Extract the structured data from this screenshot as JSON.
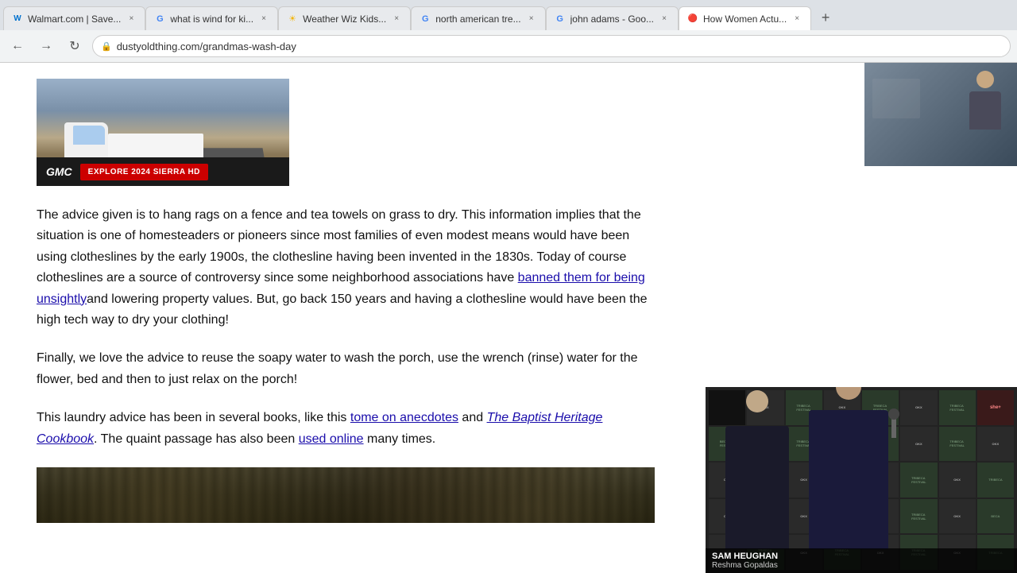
{
  "browser": {
    "tabs": [
      {
        "id": "tab1",
        "favicon": "W",
        "favicon_color": "#0071ce",
        "label": "Walmart.com | Save...",
        "active": false
      },
      {
        "id": "tab2",
        "favicon": "G",
        "favicon_color": "#4285f4",
        "label": "what is wind for ki...",
        "active": false
      },
      {
        "id": "tab3",
        "favicon": "☀",
        "favicon_color": "#f4b400",
        "label": "Weather Wiz Kids...",
        "active": false
      },
      {
        "id": "tab4",
        "favicon": "G",
        "favicon_color": "#4285f4",
        "label": "north american tre...",
        "active": false
      },
      {
        "id": "tab5",
        "favicon": "G",
        "favicon_color": "#4285f4",
        "label": "john adams - Goo...",
        "active": false
      },
      {
        "id": "tab6",
        "favicon": "H",
        "favicon_color": "#444",
        "label": "How Women Actu...",
        "active": true
      }
    ],
    "url": "dustyoldthing.com/grandmas-wash-day",
    "url_full": "dustyoldthing.com/grandmas-wash-day"
  },
  "ad": {
    "brand": "GMC",
    "cta": "EXPLORE 2024 SIERRA HD"
  },
  "article": {
    "paragraph1": "The advice given is to hang rags on a fence and tea towels on grass to dry. This information implies that the situation is one of homesteaders or pioneers since most families of even modest means would have been using clotheslines by the early 1900s, the clothesline having been invented in the 1830s. Today of course clotheslines are a source of controversy since some neighborhood associations have ",
    "p1_link": "banned them for being unsightly",
    "p1_rest": "and lowering property values. But, go back 150 years and having a clothesline would have been the high tech way to dry your clothing!",
    "paragraph2": "Finally, we love the advice to reuse the soapy water to wash the porch, use the wrench (rinse) water for the flower, bed and then to just relax on the porch!",
    "paragraph3_start": "This laundry advice has been in several books, like this ",
    "p3_link1": "tome on anecdotes",
    "p3_mid": " and ",
    "p3_link2_title": "The Baptist Heritage Cookbook",
    "p3_end": ". The quaint passage has also been ",
    "p3_link3": "used online",
    "p3_final": " many times."
  },
  "video_overlay": {
    "person_name": "SAM HEUGHAN",
    "interviewer_name": "Reshma Gopaldas"
  },
  "festival_cells": [
    "OKX",
    "TRIBECA FESTIVAL",
    "OKX",
    "TRIBECA FESTIVAL",
    "she+",
    "OKX",
    "TRIBECA FESTIVAL",
    "OKX",
    "BECA FESTIVAL",
    "OKX",
    "TRIBECA FESTIVAL",
    "OKX",
    "TRIBECA FESTIVAL",
    "OKX",
    "TRIBECA FESTIVAL",
    "OKX",
    "OKX",
    "TRIBECA FESTIVAL",
    "OKX",
    "TRIBECA",
    "OKX",
    "TRIBECA FESTIVAL",
    "OKX",
    "TRIBECA",
    "OKX",
    "BECA FESTIVAL",
    "OKX",
    "TRIBECA FESTIVAL",
    "OKX",
    "TRIBECA FESTIVAL",
    "OKX",
    "BECA",
    "OKX",
    "TRIBECA FESTIVAL",
    "OKX",
    "TRIBECA FESTIVAL",
    "OKX",
    "TRIBECA FESTIVAL",
    "OKX",
    "TRIBECA"
  ]
}
